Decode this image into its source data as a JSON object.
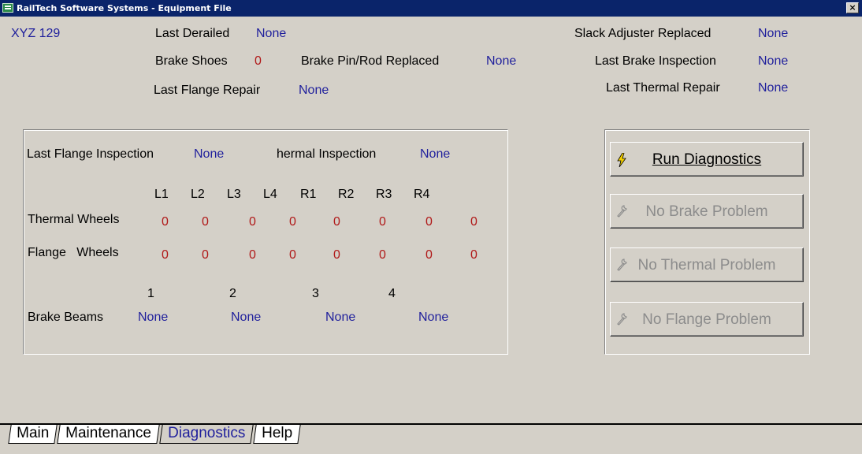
{
  "window": {
    "title": "RailTech Software Systems - Equipment File",
    "close_label": "×"
  },
  "header": {
    "car_id": "XYZ 129",
    "last_derailed_label": "Last Derailed",
    "last_derailed_value": "None",
    "brake_shoes_label": "Brake Shoes",
    "brake_shoes_value": "0",
    "brake_pin_label": "Brake Pin/Rod Replaced",
    "brake_pin_value": "None",
    "last_flange_repair_label": "Last Flange Repair",
    "last_flange_repair_value": "None",
    "slack_adjuster_label": "Slack Adjuster Replaced",
    "slack_adjuster_value": "None",
    "last_brake_inspection_label": "Last Brake Inspection",
    "last_brake_inspection_value": "None",
    "last_thermal_repair_label": "Last Thermal Repair",
    "last_thermal_repair_value": "None"
  },
  "wheels_panel": {
    "last_flange_inspection_label": "Last Flange Inspection",
    "last_flange_inspection_value": "None",
    "thermal_inspection_label": "hermal Inspection",
    "thermal_inspection_value": "None",
    "columns": [
      "L1",
      "L2",
      "L3",
      "L4",
      "R1",
      "R2",
      "R3",
      "R4"
    ],
    "thermal_label": "Thermal Wheels",
    "thermal_values": [
      "0",
      "0",
      "0",
      "0",
      "0",
      "0",
      "0",
      "0"
    ],
    "flange_label": "Flange   Wheels",
    "flange_values": [
      "0",
      "0",
      "0",
      "0",
      "0",
      "0",
      "0",
      "0"
    ],
    "beam_numbers": [
      "1",
      "2",
      "3",
      "4"
    ],
    "brake_beams_label": "Brake Beams",
    "brake_beam_values": [
      "None",
      "None",
      "None",
      "None"
    ]
  },
  "actions": {
    "run_diagnostics": {
      "label": "Run Diagnostics",
      "icon": "lightning-icon"
    },
    "no_brake": {
      "label": "No Brake Problem",
      "icon": "wrench-icon"
    },
    "no_thermal": {
      "label": "No Thermal Problem",
      "icon": "wrench-icon"
    },
    "no_flange": {
      "label": "No Flange Problem",
      "icon": "wrench-icon"
    }
  },
  "tabs": [
    {
      "label": "Main",
      "active": false
    },
    {
      "label": "Maintenance",
      "active": false
    },
    {
      "label": "Diagnostics",
      "active": true
    },
    {
      "label": "Help",
      "active": false
    }
  ],
  "colors": {
    "value_blue": "#1f1f9c",
    "count_red": "#b01818",
    "titlebar": "#0a246a",
    "face": "#d4d0c8"
  }
}
